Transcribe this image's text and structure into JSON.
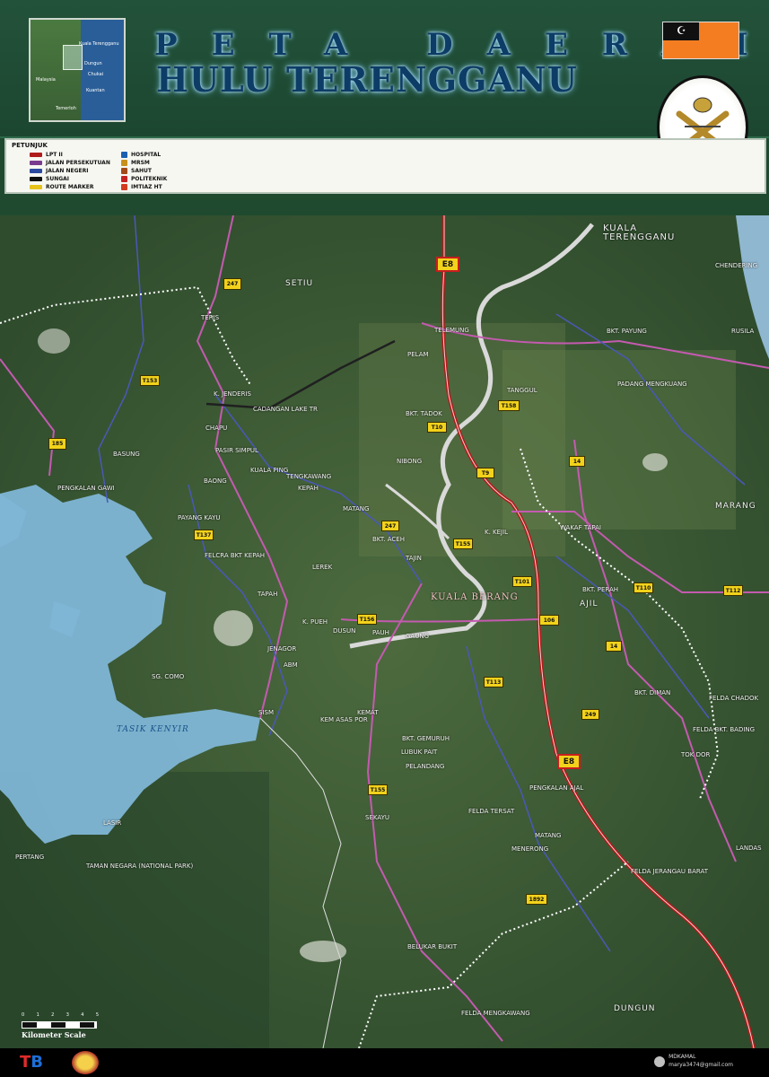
{
  "title": {
    "line1": "PETA DAERAH",
    "line2": "HULU TERENGGANU"
  },
  "inset_map": {
    "labels": [
      "Kuala Terengganu",
      "Dungun",
      "Chukai",
      "Kuantan",
      "Malaysia",
      "Temerloh"
    ]
  },
  "legend": {
    "title": "PETUNJUK",
    "items_left": [
      {
        "label": "LPT II",
        "color": "#b01c1c"
      },
      {
        "label": "JALAN PERSEKUTUAN",
        "color": "#7a3b8f"
      },
      {
        "label": "JALAN NEGERI",
        "color": "#2c4aa0"
      },
      {
        "label": "SUNGAI",
        "color": "#101010"
      },
      {
        "label": "ROUTE MARKER",
        "color": "#e6c21a"
      }
    ],
    "items_right": [
      {
        "label": "HOSPITAL",
        "icon": "hospital-icon",
        "color": "#1b5fb0"
      },
      {
        "label": "MRSM",
        "icon": "mrsm-icon",
        "color": "#c8911c"
      },
      {
        "label": "SAHUT",
        "icon": "sahut-icon",
        "color": "#a34a1a"
      },
      {
        "label": "POLITEKNIK",
        "icon": "politeknik-icon",
        "color": "#c42222"
      },
      {
        "label": "IMTIAZ HT",
        "icon": "imtiaz-icon",
        "color": "#d23b1f"
      }
    ]
  },
  "places": [
    {
      "label": "KUALA TERENGGANU",
      "cls": "kt"
    },
    {
      "label": "SETIU",
      "cls": "big"
    },
    {
      "label": "TELEMUNG",
      "cls": ""
    },
    {
      "label": "PELAM",
      "cls": ""
    },
    {
      "label": "BKT. PAYUNG",
      "cls": ""
    },
    {
      "label": "CHENDERING",
      "cls": ""
    },
    {
      "label": "RUSILA",
      "cls": ""
    },
    {
      "label": "TERIS",
      "cls": ""
    },
    {
      "label": "K. JENDERIS",
      "cls": ""
    },
    {
      "label": "CADANGAN LAKE TR",
      "cls": ""
    },
    {
      "label": "TANGGUL",
      "cls": ""
    },
    {
      "label": "PADANG MENGKUANG",
      "cls": ""
    },
    {
      "label": "BKT. TADOK",
      "cls": ""
    },
    {
      "label": "CHAPU",
      "cls": ""
    },
    {
      "label": "BASUNG",
      "cls": ""
    },
    {
      "label": "PASIR SIMPUL",
      "cls": ""
    },
    {
      "label": "KUALA PING",
      "cls": ""
    },
    {
      "label": "NIBONG",
      "cls": ""
    },
    {
      "label": "PENGKALAN GAWI",
      "cls": ""
    },
    {
      "label": "TENGKAWANG",
      "cls": ""
    },
    {
      "label": "KEPAH",
      "cls": ""
    },
    {
      "label": "BAONG",
      "cls": ""
    },
    {
      "label": "MATANG",
      "cls": ""
    },
    {
      "label": "MARANG",
      "cls": "big"
    },
    {
      "label": "WAKAF TAPAI",
      "cls": ""
    },
    {
      "label": "PAYANG KAYU",
      "cls": ""
    },
    {
      "label": "BKT. ACEH",
      "cls": ""
    },
    {
      "label": "K. KEJIL",
      "cls": ""
    },
    {
      "label": "FELCRA BKT KEPAH",
      "cls": ""
    },
    {
      "label": "LEREK",
      "cls": ""
    },
    {
      "label": "TAJIN",
      "cls": ""
    },
    {
      "label": "KUALA BERANG",
      "cls": "ks"
    },
    {
      "label": "BKT. PERAH",
      "cls": ""
    },
    {
      "label": "AJIL",
      "cls": "big"
    },
    {
      "label": "TAPAH",
      "cls": ""
    },
    {
      "label": "K. PUEH",
      "cls": ""
    },
    {
      "label": "DUSUN",
      "cls": ""
    },
    {
      "label": "PAUH",
      "cls": ""
    },
    {
      "label": "GAUNG",
      "cls": ""
    },
    {
      "label": "JENAGOR",
      "cls": ""
    },
    {
      "label": "ABM",
      "cls": ""
    },
    {
      "label": "SG. COMO",
      "cls": ""
    },
    {
      "label": "TASIK KENYIR",
      "cls": "lake"
    },
    {
      "label": "SISM",
      "cls": ""
    },
    {
      "label": "KEMAT",
      "cls": ""
    },
    {
      "label": "KEM ASAS POR",
      "cls": ""
    },
    {
      "label": "BKT. GEMURUH",
      "cls": ""
    },
    {
      "label": "BKT. DIMAN",
      "cls": ""
    },
    {
      "label": "FELDA CHADOK",
      "cls": ""
    },
    {
      "label": "FELDA BKT. BADING",
      "cls": ""
    },
    {
      "label": "LUBUK PAIT",
      "cls": ""
    },
    {
      "label": "TOK DOR",
      "cls": ""
    },
    {
      "label": "PELANDANG",
      "cls": ""
    },
    {
      "label": "PENGKALAN AJAL",
      "cls": ""
    },
    {
      "label": "FELDA TERSAT",
      "cls": ""
    },
    {
      "label": "SEKAYU",
      "cls": ""
    },
    {
      "label": "LASIR",
      "cls": ""
    },
    {
      "label": "MATANG",
      "cls": ""
    },
    {
      "label": "MENERONG",
      "cls": ""
    },
    {
      "label": "PERTANG",
      "cls": ""
    },
    {
      "label": "TAMAN NEGARA (NATIONAL PARK)",
      "cls": ""
    },
    {
      "label": "LANDAS",
      "cls": ""
    },
    {
      "label": "FELDA JERANGAU BARAT",
      "cls": ""
    },
    {
      "label": "BELUKAR BUKIT",
      "cls": ""
    },
    {
      "label": "DUNGUN",
      "cls": "big"
    },
    {
      "label": "FELDA MENGKAWANG",
      "cls": ""
    }
  ],
  "route_markers": [
    {
      "label": "E8",
      "cls": "e8"
    },
    {
      "label": "247",
      "cls": ""
    },
    {
      "label": "T153",
      "cls": ""
    },
    {
      "label": "185",
      "cls": ""
    },
    {
      "label": "T158",
      "cls": ""
    },
    {
      "label": "T10",
      "cls": ""
    },
    {
      "label": "T9",
      "cls": ""
    },
    {
      "label": "14",
      "cls": ""
    },
    {
      "label": "247",
      "cls": ""
    },
    {
      "label": "T137",
      "cls": ""
    },
    {
      "label": "T155",
      "cls": ""
    },
    {
      "label": "T101",
      "cls": ""
    },
    {
      "label": "T110",
      "cls": ""
    },
    {
      "label": "T112",
      "cls": ""
    },
    {
      "label": "106",
      "cls": ""
    },
    {
      "label": "T156",
      "cls": ""
    },
    {
      "label": "14",
      "cls": ""
    },
    {
      "label": "T113",
      "cls": ""
    },
    {
      "label": "249",
      "cls": ""
    },
    {
      "label": "E8",
      "cls": "e8"
    },
    {
      "label": "T155",
      "cls": ""
    },
    {
      "label": "1892",
      "cls": ""
    }
  ],
  "scale": {
    "ticks": [
      "0",
      "1",
      "2",
      "3",
      "4",
      "5"
    ],
    "caption": "Kilometer Scale"
  },
  "footer": {
    "logo_left": "T",
    "logo_right": "B",
    "credit_name": "MDKAMAL",
    "credit_email": "marya3474@gmail.com"
  },
  "colors": {
    "highway": "#b01c1c",
    "federal_road": "#7a3b8f",
    "state_road": "#3b4aa8",
    "river": "#d9d9d9",
    "lake": "#7fb6d6",
    "header": "#1f4a30"
  }
}
